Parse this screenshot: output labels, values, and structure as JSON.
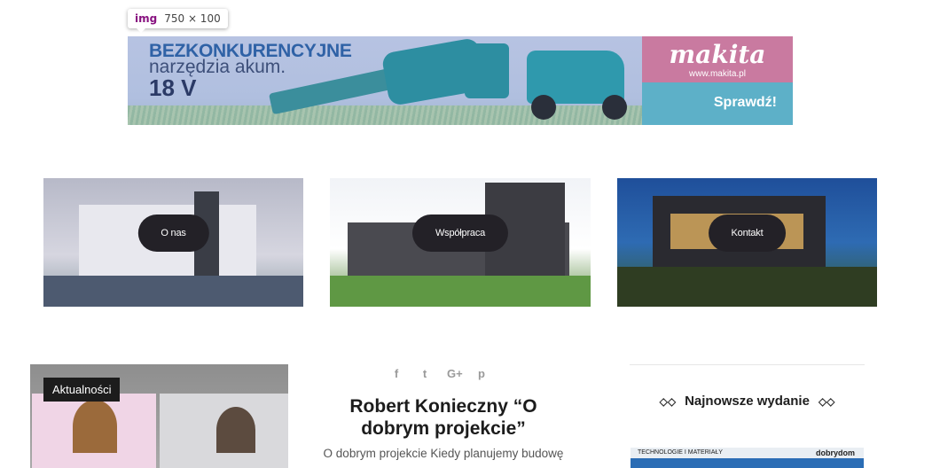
{
  "tooltip": {
    "tag": "img",
    "dims": "750 × 100"
  },
  "banner": {
    "line1": "BEZKONKURENCYJNE",
    "line2": "narzędzia akum.",
    "line3": "18 V",
    "brand": "makita",
    "url": "www.makita.pl",
    "cta": "Sprawdź!"
  },
  "tiles": [
    {
      "label": "O nas"
    },
    {
      "label": "Współpraca"
    },
    {
      "label": "Kontakt"
    }
  ],
  "news": {
    "category": "Aktualności",
    "title": "Robert Konieczny “O dobrym projekcie”",
    "excerpt": "O dobrym projekcie Kiedy planujemy budowę"
  },
  "social": {
    "facebook": "f",
    "twitter": "t",
    "googleplus": "G+",
    "pinterest": "p"
  },
  "sidebar": {
    "heading": "Najnowsze wydanie",
    "magazine_top": "TECHNOLOGIE I MATERIAŁY",
    "magazine_brand": "dobrydom"
  }
}
